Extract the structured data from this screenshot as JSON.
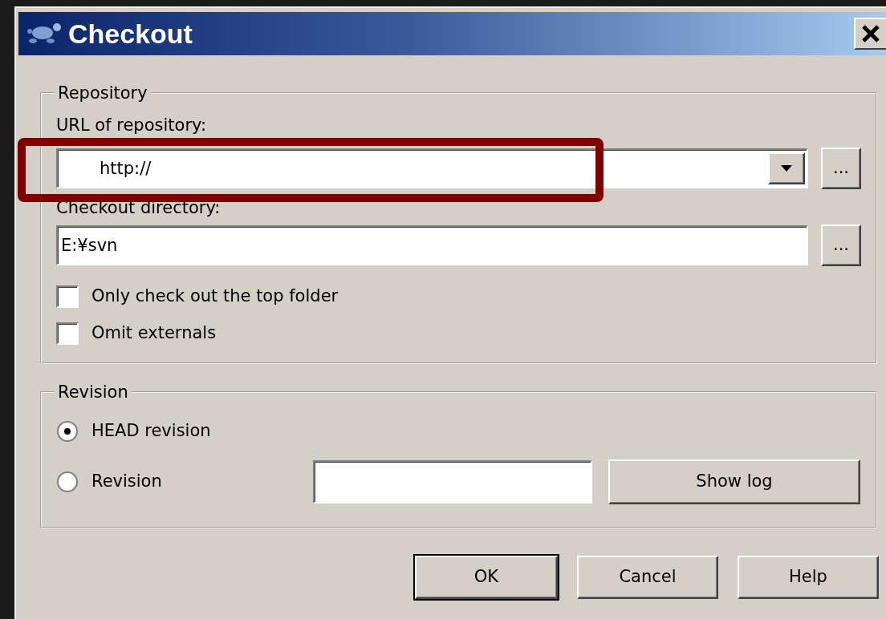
{
  "window": {
    "title": "Checkout"
  },
  "repository": {
    "legend": "Repository",
    "url_label": "URL of repository:",
    "url_value": "http://",
    "url_browse": "...",
    "dir_label": "Checkout directory:",
    "dir_value": "E:¥svn",
    "dir_browse": "...",
    "options": [
      {
        "label": "Only check out the top folder",
        "checked": false
      },
      {
        "label": "Omit externals",
        "checked": false
      }
    ]
  },
  "revision": {
    "legend": "Revision",
    "choices": [
      {
        "label": "HEAD revision",
        "selected": true
      },
      {
        "label": "Revision",
        "selected": false
      }
    ],
    "show_log": "Show log"
  },
  "buttons": [
    {
      "label": "OK",
      "default": true
    },
    {
      "label": "Cancel",
      "default": false
    },
    {
      "label": "Help",
      "default": false
    }
  ],
  "annotation_frame": true
}
